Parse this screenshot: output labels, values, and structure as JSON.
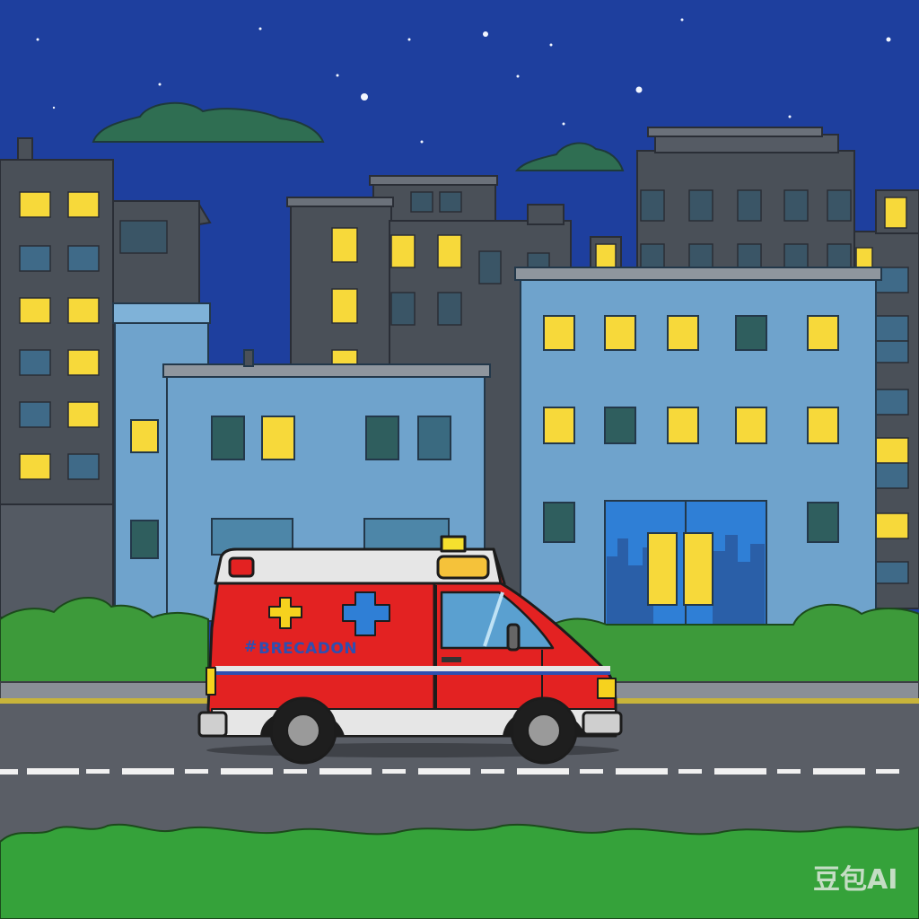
{
  "scene": {
    "description_tags": [
      "night",
      "city-street",
      "ambulance",
      "buildings",
      "stars"
    ],
    "colors": {
      "sky": "#1e3f9e",
      "building_dark": "#4a5058",
      "building_light": "#6fa3cc",
      "window_lit": "#f7d93a",
      "window_dark": "#34586a",
      "grass": "#3d9a3a",
      "road": "#5a5e66",
      "ambulance_red": "#e32222",
      "ambulance_white": "#e6e6e6",
      "cross_blue": "#2f7fd6",
      "cross_yellow": "#f6d21e"
    }
  },
  "ambulance": {
    "side_text": "BRECADON",
    "side_prefix": "#"
  },
  "watermark": {
    "text": "豆包AI"
  }
}
